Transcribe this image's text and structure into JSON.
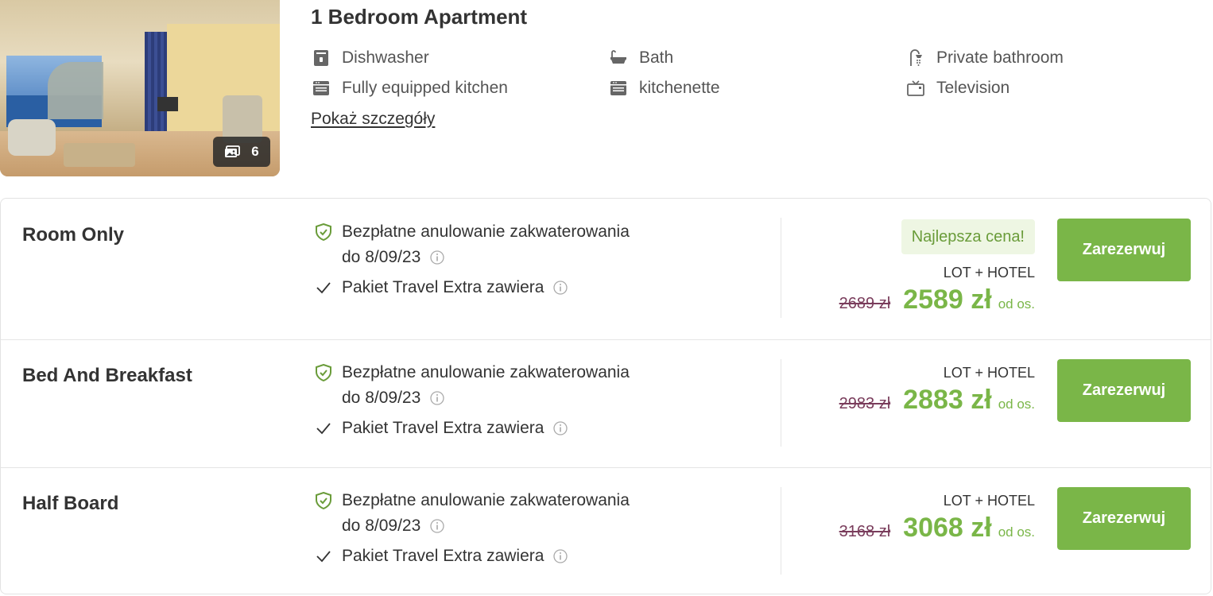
{
  "room": {
    "title": "1 Bedroom Apartment",
    "photo_count": "6",
    "details_link": "Pokaż szczegóły",
    "amenities": [
      {
        "label": "Dishwasher",
        "icon": "dishwasher-icon"
      },
      {
        "label": "Bath",
        "icon": "bathtub-icon"
      },
      {
        "label": "Private bathroom",
        "icon": "shower-icon"
      },
      {
        "label": "Fully equipped kitchen",
        "icon": "kitchen-icon"
      },
      {
        "label": "kitchenette",
        "icon": "kitchenette-icon"
      },
      {
        "label": "Television",
        "icon": "tv-icon"
      }
    ]
  },
  "offers": [
    {
      "name": "Room Only",
      "cancellation": "Bezpłatne anulowanie zakwaterowania",
      "cancellation_date": "do 8/09/23",
      "package": "Pakiet Travel Extra zawiera",
      "badge": "Najlepsza cena!",
      "type": "LOT + HOTEL",
      "old_price": "2689 zł",
      "price": "2589 zł",
      "per_person": "od os.",
      "button": "Zarezerwuj"
    },
    {
      "name": "Bed And Breakfast",
      "cancellation": "Bezpłatne anulowanie zakwaterowania",
      "cancellation_date": "do 8/09/23",
      "package": "Pakiet Travel Extra zawiera",
      "type": "LOT + HOTEL",
      "old_price": "2983 zł",
      "price": "2883 zł",
      "per_person": "od os.",
      "button": "Zarezerwuj"
    },
    {
      "name": "Half Board",
      "cancellation": "Bezpłatne anulowanie zakwaterowania",
      "cancellation_date": "do 8/09/23",
      "package": "Pakiet Travel Extra zawiera",
      "type": "LOT + HOTEL",
      "old_price": "3168 zł",
      "price": "3068 zł",
      "per_person": "od os.",
      "button": "Zarezerwuj"
    }
  ],
  "colors": {
    "accent_green": "#7ab648",
    "badge_bg": "#eef6e3",
    "old_price": "#7a3d5c",
    "text": "#333333"
  }
}
